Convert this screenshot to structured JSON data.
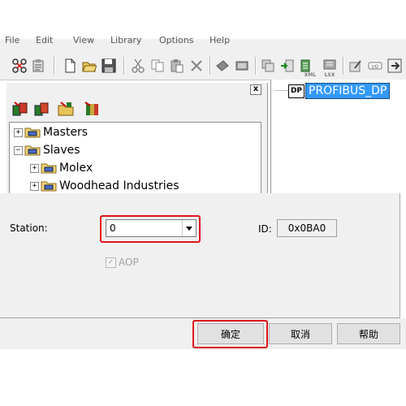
{
  "menubar": {
    "items": [
      "File",
      "Edit",
      "View",
      "Library",
      "Options",
      "Help"
    ]
  },
  "toolbar": {
    "xml_label": "XML",
    "lsx_label": "LSX"
  },
  "left_pane": {
    "close_label": "x",
    "tree": [
      {
        "label": "Masters",
        "expander": "+"
      },
      {
        "label": "Slaves",
        "expander": "−"
      },
      {
        "label": "Molex",
        "expander": "+"
      },
      {
        "label": "Woodhead Industries",
        "expander": "+"
      }
    ]
  },
  "right_pane": {
    "node_icon": "DP",
    "node_label": "PROFIBUS_DP"
  },
  "dialog": {
    "station_label": "Station:",
    "station_value": "0",
    "id_label": "ID:",
    "id_value": "0x0BA0",
    "aop_label": "AOP",
    "aop_checked": false,
    "ok_label": "确定",
    "cancel_label": "取消",
    "help_label": "帮助"
  },
  "colors": {
    "highlight": "#e0141c",
    "selection": "#3399ff"
  }
}
